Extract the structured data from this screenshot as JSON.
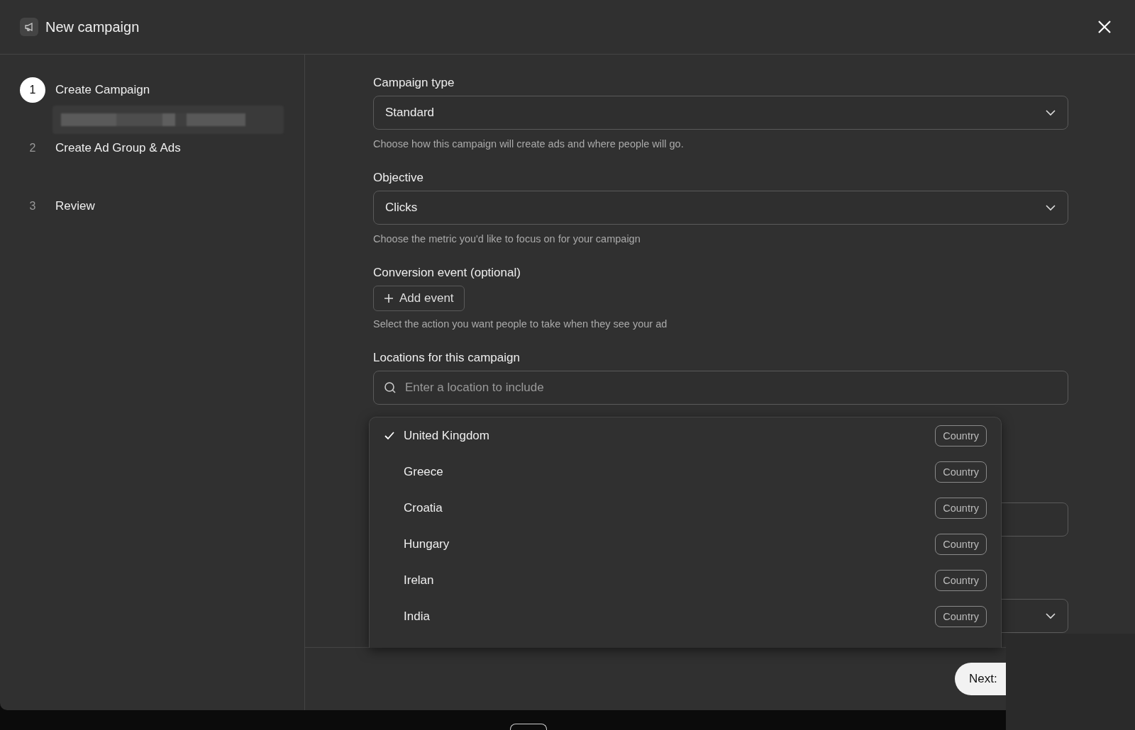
{
  "dialog": {
    "title": "New campaign"
  },
  "steps": [
    {
      "number": "1",
      "label": "Create Campaign",
      "selected": true,
      "blurred_detail": true
    },
    {
      "number": "2",
      "label": "Create Ad Group & Ads",
      "selected": false,
      "blurred_detail": false
    },
    {
      "number": "3",
      "label": "Review",
      "selected": false,
      "blurred_detail": false
    }
  ],
  "fields": [
    {
      "kind": "select",
      "label": "Campaign type",
      "value": "Standard",
      "help": "Choose how this campaign will create ads and where people will go."
    },
    {
      "kind": "select",
      "label": "Objective",
      "value": "Clicks",
      "help": "Choose the metric you'd like to focus on for your campaign"
    },
    {
      "kind": "add",
      "label": "Conversion event (optional)",
      "value": "Add event",
      "help": "Select the action you want people to take when they see your ad"
    },
    {
      "kind": "search",
      "label": "Locations for this campaign",
      "placeholder": "Enter a location to include"
    }
  ],
  "location_options": [
    {
      "name": "United Kingdom",
      "tag": "Country",
      "selected": true
    },
    {
      "name": "Greece",
      "tag": "Country",
      "selected": false
    },
    {
      "name": "Croatia",
      "tag": "Country",
      "selected": false
    },
    {
      "name": "Hungary",
      "tag": "Country",
      "selected": false
    },
    {
      "name": "Irelan",
      "tag": "Country",
      "selected": false
    },
    {
      "name": "India",
      "tag": "Country",
      "selected": false
    }
  ],
  "footer": {
    "next_button": "Next:"
  }
}
